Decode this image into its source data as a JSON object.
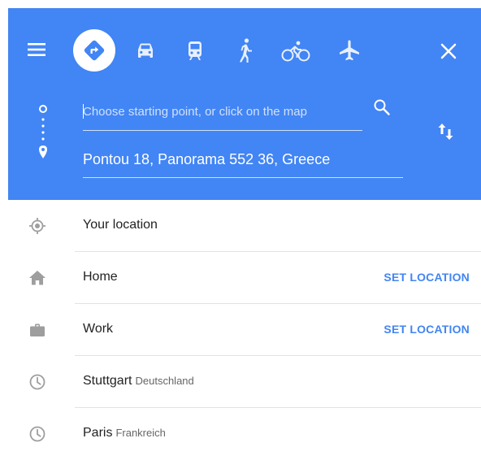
{
  "colors": {
    "header_bg": "#4285f4",
    "accent": "#4285f4",
    "icon_grey": "#9e9e9e"
  },
  "topbar": {
    "icons": [
      "menu-icon",
      "directions-icon",
      "car-icon",
      "transit-icon",
      "walk-icon",
      "bike-icon",
      "flight-icon",
      "close-icon"
    ],
    "active_mode": "best-route"
  },
  "route": {
    "origin_placeholder": "Choose starting point, or click on the map",
    "origin_value": "",
    "destination": "Pontou 18, Panorama 552 36, Greece"
  },
  "suggestions": [
    {
      "icon": "my-location-icon",
      "label": "Your location",
      "sub": "",
      "action": ""
    },
    {
      "icon": "home-icon",
      "label": "Home",
      "sub": "",
      "action": "SET LOCATION"
    },
    {
      "icon": "work-icon",
      "label": "Work",
      "sub": "",
      "action": "SET LOCATION"
    },
    {
      "icon": "history-icon",
      "label": "Stuttgart",
      "sub": "Deutschland",
      "action": ""
    },
    {
      "icon": "history-icon",
      "label": "Paris",
      "sub": "Frankreich",
      "action": ""
    }
  ]
}
